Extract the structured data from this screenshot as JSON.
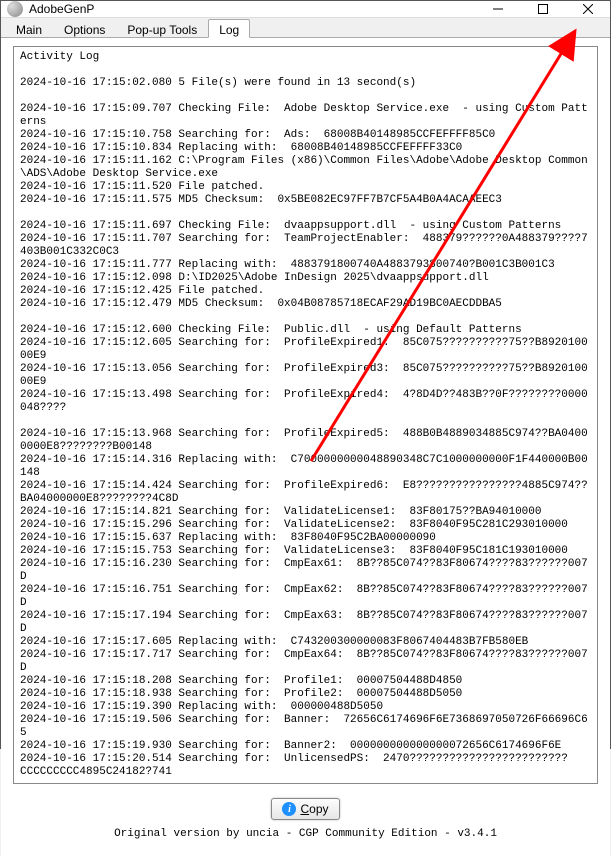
{
  "window": {
    "title": "AdobeGenP"
  },
  "tabs": {
    "main": "Main",
    "options": "Options",
    "popup": "Pop-up Tools",
    "log": "Log",
    "active": "log"
  },
  "log": {
    "header": "Activity Log",
    "lines": [
      "2024-10-16 17:15:02.080 5 File(s) were found in 13 second(s)",
      "",
      "2024-10-16 17:15:09.707 Checking File:  Adobe Desktop Service.exe  - using Custom Patterns",
      "2024-10-16 17:15:10.758 Searching for:  Ads:  68008B40148985CCFEFFFF85C0",
      "2024-10-16 17:15:10.834 Replacing with:  68008B40148985CCFEFFFF33C0",
      "2024-10-16 17:15:11.162 C:\\Program Files (x86)\\Common Files\\Adobe\\Adobe Desktop Common\\ADS\\Adobe Desktop Service.exe",
      "2024-10-16 17:15:11.520 File patched.",
      "2024-10-16 17:15:11.575 MD5 Checksum:  0x5BE082EC97FF7B7CF5A4B0A4ACAAEEC3",
      "",
      "2024-10-16 17:15:11.697 Checking File:  dvaappsupport.dll  - using Custom Patterns",
      "2024-10-16 17:15:11.707 Searching for:  TeamProjectEnabler:  488379??????0A488379????7403B001C332C0C3",
      "2024-10-16 17:15:11.777 Replacing with:  4883791800740A4883793800740?B001C3B001C3",
      "2024-10-16 17:15:12.098 D:\\ID2025\\Adobe InDesign 2025\\dvaappsupport.dll",
      "2024-10-16 17:15:12.425 File patched.",
      "2024-10-16 17:15:12.479 MD5 Checksum:  0x04B08785718ECAF29AD19BC0AECDDBA5",
      "",
      "2024-10-16 17:15:12.600 Checking File:  Public.dll  - using Default Patterns",
      "2024-10-16 17:15:12.605 Searching for:  ProfileExpired1:  85C075??????????75??B892010000E9",
      "2024-10-16 17:15:13.056 Searching for:  ProfileExpired3:  85C075??????????75??B892010000E9",
      "2024-10-16 17:15:13.498 Searching for:  ProfileExpired4:  4?8D4D??483B??0F????????0000048????",
      "",
      "2024-10-16 17:15:13.968 Searching for:  ProfileExpired5:  488B0B4889034885C974??BA04000000E8????????B00148",
      "2024-10-16 17:15:14.316 Replacing with:  C7000000000048890348C7C1000000000F1F440000B00148",
      "2024-10-16 17:15:14.424 Searching for:  ProfileExpired6:  E8????????????????4885C974??BA04000000E8????????4C8D",
      "2024-10-16 17:15:14.821 Searching for:  ValidateLicense1:  83F80175??BA94010000",
      "2024-10-16 17:15:15.296 Searching for:  ValidateLicense2:  83F8040F95C281C293010000",
      "2024-10-16 17:15:15.637 Replacing with:  83F8040F95C2BA00000090",
      "2024-10-16 17:15:15.753 Searching for:  ValidateLicense3:  83F8040F95C181C193010000",
      "2024-10-16 17:15:16.230 Searching for:  CmpEax61:  8B??85C074??83F80674????83??????007D",
      "2024-10-16 17:15:16.751 Searching for:  CmpEax62:  8B??85C074??83F80674????83??????007D",
      "2024-10-16 17:15:17.194 Searching for:  CmpEax63:  8B??85C074??83F80674????83??????007D",
      "2024-10-16 17:15:17.605 Replacing with:  C743200300000083F8067404483B7FB580EB",
      "2024-10-16 17:15:17.717 Searching for:  CmpEax64:  8B??85C074??83F80674????83??????007D",
      "2024-10-16 17:15:18.208 Searching for:  Profile1:  00007504488D4850",
      "2024-10-16 17:15:18.938 Searching for:  Profile2:  00007504488D5050",
      "2024-10-16 17:15:19.390 Replacing with:  000000488D5050",
      "2024-10-16 17:15:19.506 Searching for:  Banner:  72656C6174696F6E7368697050726F66696C65",
      "2024-10-16 17:15:19.930 Searching for:  Banner2:  000000000000000072656C6174696F6E",
      "2024-10-16 17:15:20.514 Searching for:  UnlicensedPS:  2470????????????????????????",
      "CCCCCCCCC4895C24182?741"
    ]
  },
  "buttons": {
    "copy": "Copy"
  },
  "footer": {
    "text": "Original version by uncia - CGP Community Edition - v3.4.1"
  }
}
